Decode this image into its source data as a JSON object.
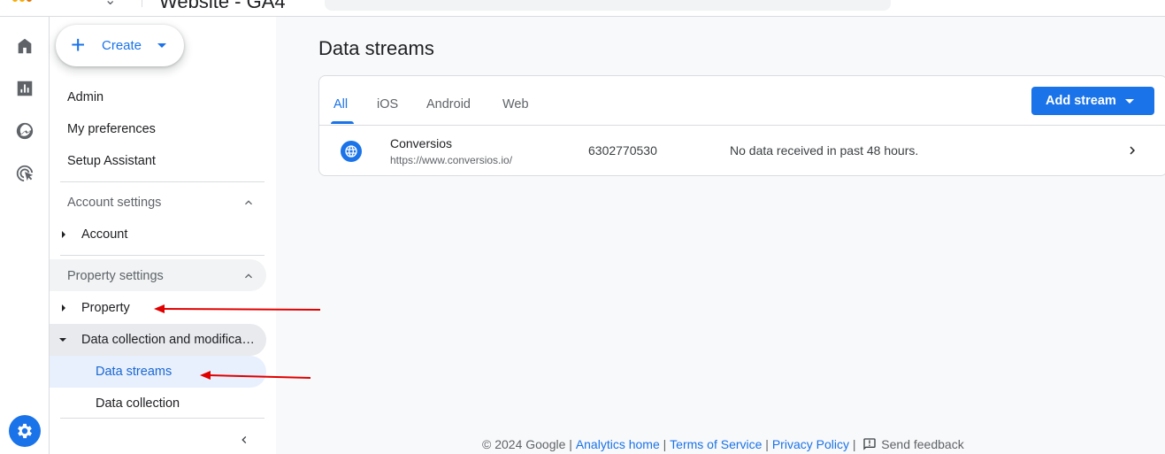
{
  "topbar": {
    "title": "Website - GA4"
  },
  "nav": {
    "create_label": "Create",
    "items": {
      "admin": "Admin",
      "my_preferences": "My preferences",
      "setup_assistant": "Setup Assistant",
      "account_settings": "Account settings",
      "account": "Account",
      "property_settings": "Property settings",
      "property": "Property",
      "data_collection_modification": "Data collection and modifica…",
      "data_streams": "Data streams",
      "data_collection": "Data collection"
    }
  },
  "main": {
    "title": "Data streams",
    "tabs": [
      "All",
      "iOS",
      "Android",
      "Web"
    ],
    "active_tab": "All",
    "add_stream_label": "Add stream",
    "streams": [
      {
        "name": "Conversios",
        "url": "https://www.conversios.io/",
        "id": "6302770530",
        "status": "No data received in past 48 hours."
      }
    ]
  },
  "footer": {
    "copyright": "© 2024 Google",
    "analytics_home": "Analytics home",
    "terms": "Terms of Service",
    "privacy": "Privacy Policy",
    "feedback": "Send feedback"
  },
  "colors": {
    "accent": "#1a73e8",
    "annotation_arrow": "#e00000"
  }
}
